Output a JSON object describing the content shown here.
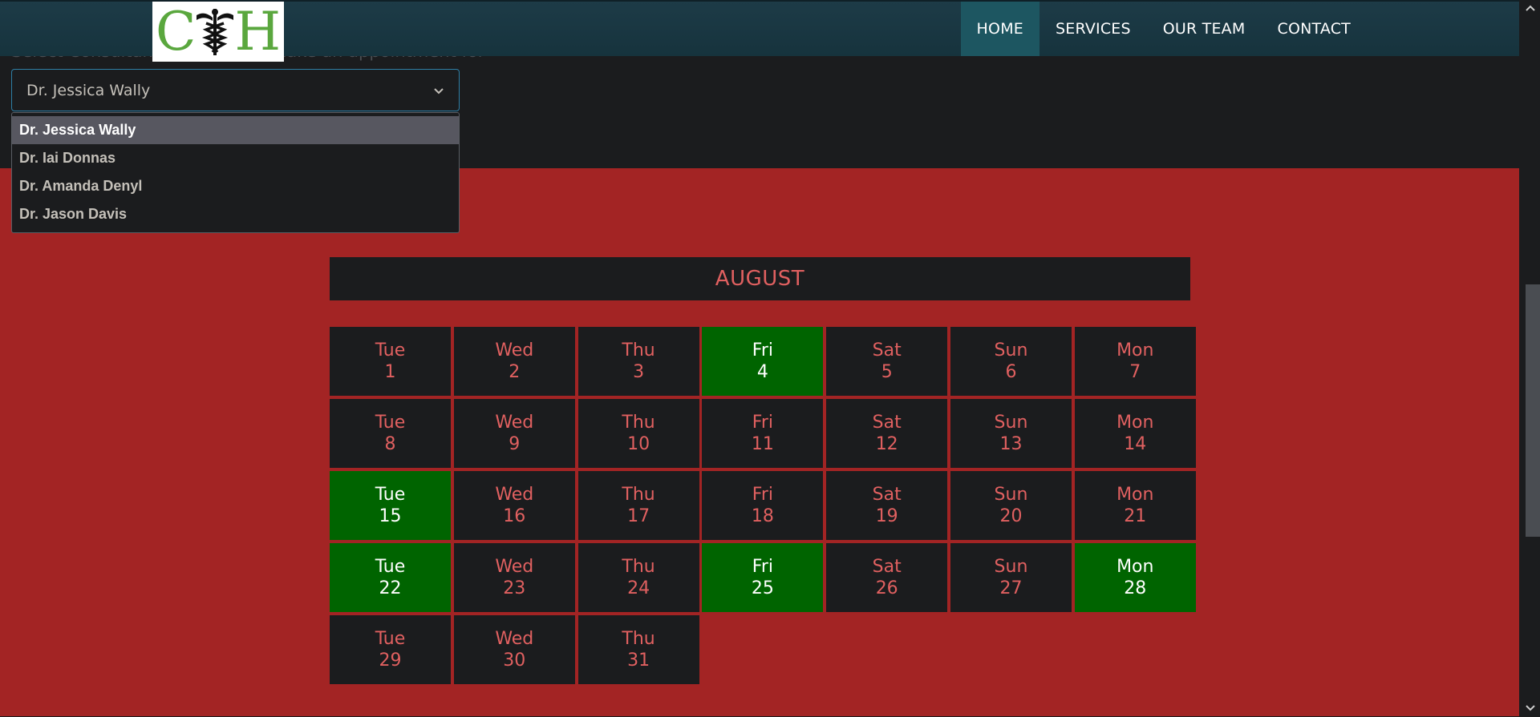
{
  "logo": {
    "left": "C",
    "right": "H"
  },
  "nav": {
    "items": [
      {
        "label": "HOME",
        "active": true
      },
      {
        "label": "SERVICES",
        "active": false
      },
      {
        "label": "OUR TEAM",
        "active": false
      },
      {
        "label": "CONTACT",
        "active": false
      }
    ]
  },
  "consultant": {
    "label": "Select Consultant you want to make an appointment for",
    "selected": "Dr. Jessica Wally",
    "options": [
      "Dr. Jessica Wally",
      "Dr. Iai Donnas",
      "Dr. Amanda Denyl",
      "Dr. Jason Davis"
    ]
  },
  "calendar": {
    "month": "AUGUST",
    "days": [
      {
        "dow": "Tue",
        "num": "1",
        "available": false
      },
      {
        "dow": "Wed",
        "num": "2",
        "available": false
      },
      {
        "dow": "Thu",
        "num": "3",
        "available": false
      },
      {
        "dow": "Fri",
        "num": "4",
        "available": true
      },
      {
        "dow": "Sat",
        "num": "5",
        "available": false
      },
      {
        "dow": "Sun",
        "num": "6",
        "available": false
      },
      {
        "dow": "Mon",
        "num": "7",
        "available": false
      },
      {
        "dow": "Tue",
        "num": "8",
        "available": false
      },
      {
        "dow": "Wed",
        "num": "9",
        "available": false
      },
      {
        "dow": "Thu",
        "num": "10",
        "available": false
      },
      {
        "dow": "Fri",
        "num": "11",
        "available": false
      },
      {
        "dow": "Sat",
        "num": "12",
        "available": false
      },
      {
        "dow": "Sun",
        "num": "13",
        "available": false
      },
      {
        "dow": "Mon",
        "num": "14",
        "available": false
      },
      {
        "dow": "Tue",
        "num": "15",
        "available": true
      },
      {
        "dow": "Wed",
        "num": "16",
        "available": false
      },
      {
        "dow": "Thu",
        "num": "17",
        "available": false
      },
      {
        "dow": "Fri",
        "num": "18",
        "available": false
      },
      {
        "dow": "Sat",
        "num": "19",
        "available": false
      },
      {
        "dow": "Sun",
        "num": "20",
        "available": false
      },
      {
        "dow": "Mon",
        "num": "21",
        "available": false
      },
      {
        "dow": "Tue",
        "num": "22",
        "available": true
      },
      {
        "dow": "Wed",
        "num": "23",
        "available": false
      },
      {
        "dow": "Thu",
        "num": "24",
        "available": false
      },
      {
        "dow": "Fri",
        "num": "25",
        "available": true
      },
      {
        "dow": "Sat",
        "num": "26",
        "available": false
      },
      {
        "dow": "Sun",
        "num": "27",
        "available": false
      },
      {
        "dow": "Mon",
        "num": "28",
        "available": true
      },
      {
        "dow": "Tue",
        "num": "29",
        "available": false
      },
      {
        "dow": "Wed",
        "num": "30",
        "available": false
      },
      {
        "dow": "Thu",
        "num": "31",
        "available": false
      }
    ]
  },
  "colors": {
    "available": "#006400",
    "unavailable_text": "#e06060",
    "section_bg": "#a32424",
    "nav_bg": "#1d3b47"
  }
}
